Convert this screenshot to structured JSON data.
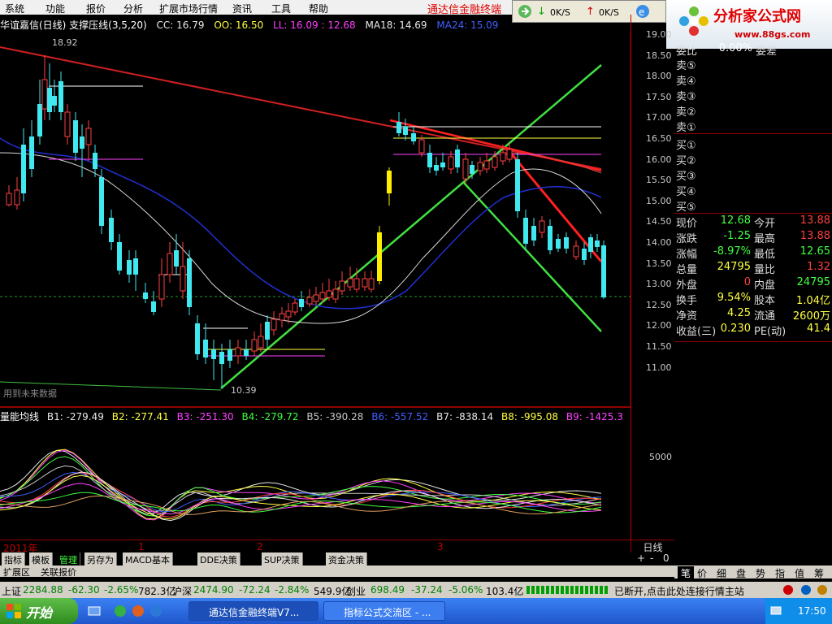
{
  "menu": [
    "系统",
    "功能",
    "报价",
    "分析",
    "扩展市场行情",
    "资讯",
    "工具",
    "帮助"
  ],
  "brand": "通达信金融终端",
  "netbar": {
    "ok1": "0K/S",
    "ok2": "0K/S"
  },
  "logo": {
    "title": "分析家公式网",
    "url": "www.88gs.com"
  },
  "main_chart": {
    "title": "华谊嘉信(日线) 支撑压线(3,5,20)",
    "indicators": [
      {
        "label": "CC: 16.79",
        "color": "#e8e8e8"
      },
      {
        "label": "OO: 16.50",
        "color": "#ffff40"
      },
      {
        "label": "LL: 16.09 : 12.68",
        "color": "#ff40ff"
      },
      {
        "label": "MA18: 14.69",
        "color": "#e8e8e8"
      },
      {
        "label": "MA24: 15.09",
        "color": "#4060ff"
      }
    ],
    "price_high_label": "18.92",
    "price_low_label": "10.39",
    "future_note": "用到未来数据",
    "y_ticks": [
      "19.00",
      "18.50",
      "18.00",
      "17.50",
      "17.00",
      "16.50",
      "16.00",
      "15.50",
      "15.00",
      "14.50",
      "14.00",
      "13.50",
      "13.00",
      "12.50",
      "12.00",
      "11.50",
      "11.00"
    ]
  },
  "lower_chart": {
    "title": "量能均线",
    "series_labels": [
      {
        "label": "B1: -279.49",
        "color": "#e8e8e8"
      },
      {
        "label": "B2: -277.41",
        "color": "#ffff40"
      },
      {
        "label": "B3: -251.30",
        "color": "#ff40ff"
      },
      {
        "label": "B4: -279.72",
        "color": "#40ff40"
      },
      {
        "label": "B5: -390.28",
        "color": "#c8c8c8"
      },
      {
        "label": "B6: -557.52",
        "color": "#4060ff"
      },
      {
        "label": "B7: -838.14",
        "color": "#e8e8e8"
      },
      {
        "label": "B8: -995.08",
        "color": "#ffff40"
      },
      {
        "label": "B9: -1425.3",
        "color": "#ff40ff"
      }
    ],
    "y_tick": "5000"
  },
  "x_axis": {
    "year": "2011年",
    "months": [
      "1",
      "2",
      "3"
    ],
    "period": "日线"
  },
  "quote": {
    "top_partial": {
      "label": "委比",
      "value": "0.00%",
      "label2": "委差"
    },
    "sell": [
      "卖⑤",
      "卖④",
      "卖③",
      "卖②",
      "卖①"
    ],
    "buy": [
      "买①",
      "买②",
      "买③",
      "买④",
      "买⑤"
    ],
    "rows": [
      {
        "l1": "现价",
        "v1": "12.68",
        "c1": "#40ff40",
        "l2": "今开",
        "v2": "13.88",
        "c2": "#ff4040"
      },
      {
        "l1": "涨跌",
        "v1": "-1.25",
        "c1": "#40ff40",
        "l2": "最高",
        "v2": "13.88",
        "c2": "#ff4040"
      },
      {
        "l1": "涨幅",
        "v1": "-8.97%",
        "c1": "#40ff40",
        "l2": "最低",
        "v2": "12.65",
        "c2": "#40ff40"
      },
      {
        "l1": "总量",
        "v1": "24795",
        "c1": "#ffff40",
        "l2": "量比",
        "v2": "1.32",
        "c2": "#ff4040"
      },
      {
        "l1": "外盘",
        "v1": "0",
        "c1": "#ff4040",
        "l2": "内盘",
        "v2": "24795",
        "c2": "#40ff40"
      },
      {
        "l1": "换手",
        "v1": "9.54%",
        "c1": "#ffff40",
        "l2": "股本",
        "v2": "1.04亿",
        "c2": "#ffff40"
      },
      {
        "l1": "净资",
        "v1": "4.25",
        "c1": "#ffff40",
        "l2": "流通",
        "v2": "2600万",
        "c2": "#ffff40"
      },
      {
        "l1": "收益(三)",
        "v1": "0.230",
        "c1": "#ffff40",
        "l2": "PE(动)",
        "v2": "41.4",
        "c2": "#ffff40"
      }
    ]
  },
  "bottom_tabs": [
    "指标",
    "模板",
    "管理",
    "另存为",
    "MACD基本",
    "DDE决策",
    "SUP决策",
    "资金决策"
  ],
  "zoom_controls": [
    "+",
    "-",
    "0"
  ],
  "side_tabs": [
    "笔",
    "价",
    "细",
    "盘",
    "势",
    "指",
    "值",
    "筹"
  ],
  "mini_tabs": [
    "扩展区",
    "关联报价"
  ],
  "status": {
    "sh_label": "上证",
    "sh_val": "2284.88",
    "sh_chg": "-62.30",
    "sh_pct": "-2.65%",
    "sh_amt": "782.3亿",
    "sz_label": "沪深",
    "sz_val": "2474.90",
    "sz_chg": "-72.24",
    "sz_pct": "-2.84%",
    "sz_amt": "549.9亿",
    "cy_label": "创业",
    "cy_val": "698.49",
    "cy_chg": "-37.24",
    "cy_pct": "-5.06%",
    "cy_amt": "103.4亿",
    "msg": "已断开,点击此处连接行情主站"
  },
  "taskbar": {
    "start": "开始",
    "tasks": [
      "通达信金融终端V7...",
      "指标公式交流区 - ..."
    ],
    "time": "17:50"
  }
}
